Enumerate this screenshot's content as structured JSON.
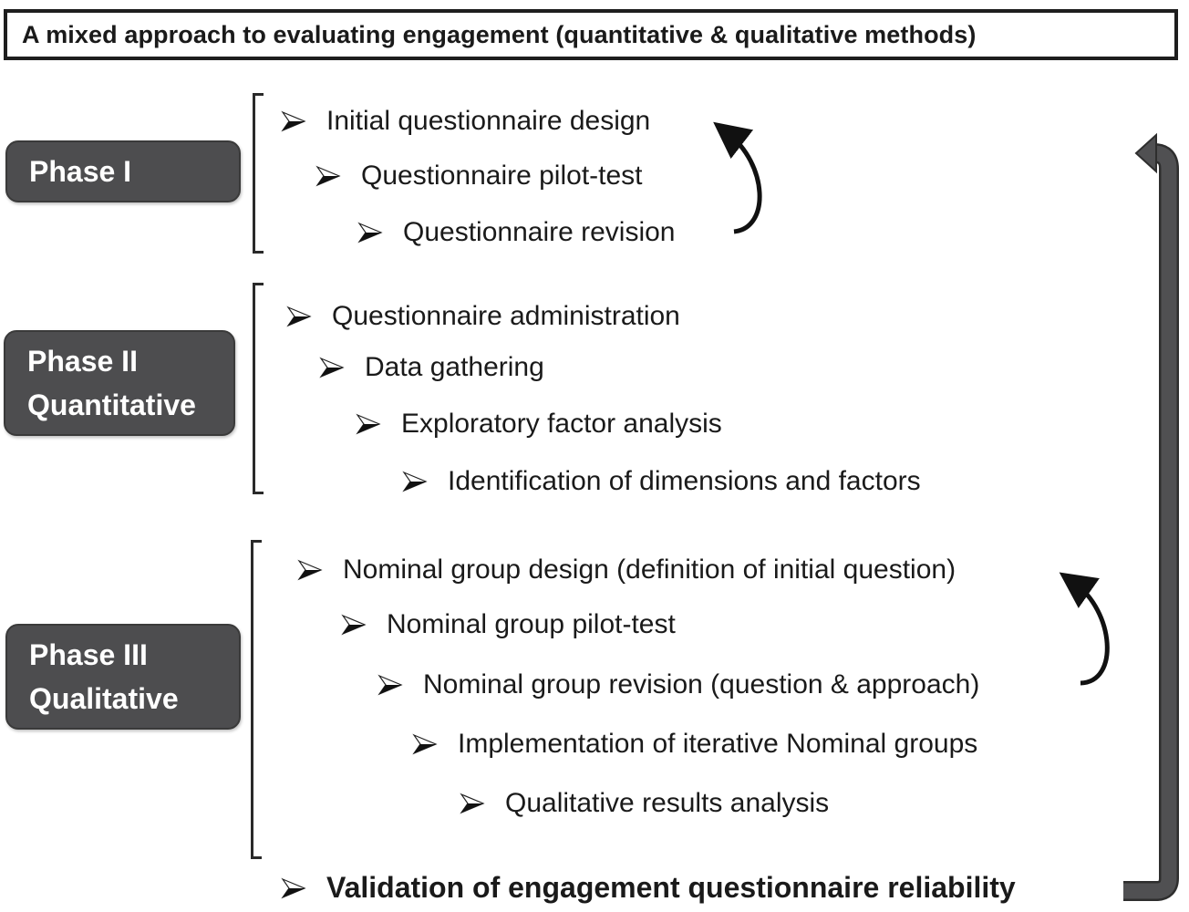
{
  "title": "A mixed approach to evaluating engagement (quantitative & qualitative methods)",
  "phases": [
    {
      "label_lines": [
        "Phase I"
      ],
      "steps": [
        "Initial questionnaire design",
        "Questionnaire pilot-test",
        "Questionnaire revision"
      ]
    },
    {
      "label_lines": [
        "Phase II",
        "Quantitative"
      ],
      "steps": [
        "Questionnaire administration",
        "Data gathering",
        "Exploratory factor analysis",
        "Identification of dimensions and factors"
      ]
    },
    {
      "label_lines": [
        "Phase III",
        "Qualitative"
      ],
      "steps": [
        "Nominal group design (definition of initial question)",
        "Nominal group pilot-test",
        "Nominal group revision (question & approach)",
        "Implementation of iterative Nominal groups",
        "Qualitative results analysis"
      ]
    }
  ],
  "final_step": "Validation of engagement questionnaire reliability",
  "icons": {
    "bullet": "arrowhead-bullet-icon",
    "loop_arrow": "curved-loop-arrow-icon",
    "feedback_arrow": "feedback-return-arrow-icon"
  },
  "colors": {
    "phase_box": "#4d4d4f",
    "phase_text": "#ffffff",
    "text": "#1a1a1a",
    "feedback_arrow": "#4d4d4f"
  }
}
